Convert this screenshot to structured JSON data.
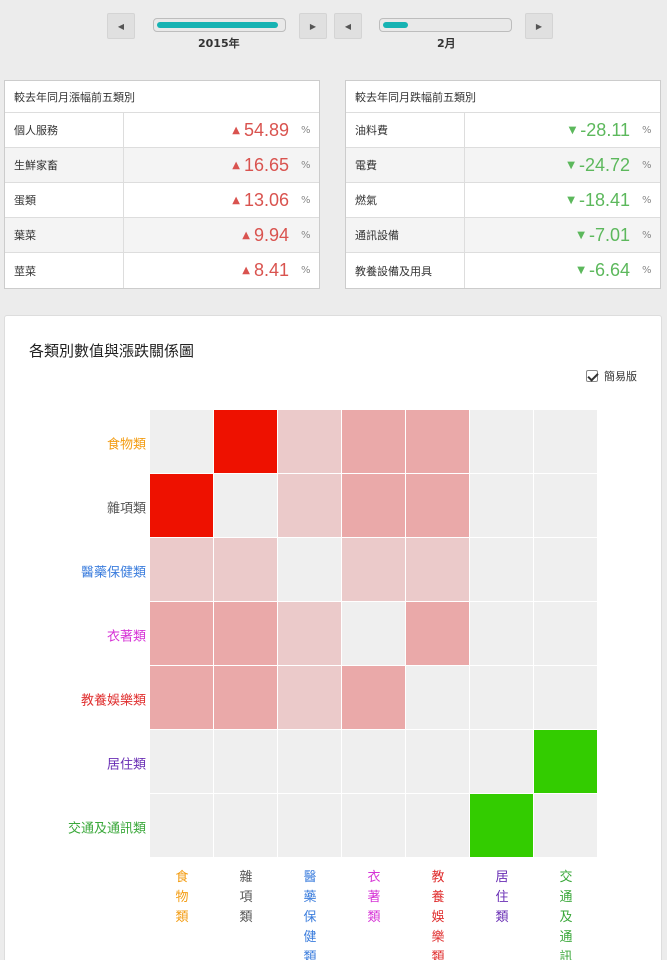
{
  "controls": {
    "year_label": "2015年",
    "month_label": "2月",
    "year_progress": 0.95,
    "month_progress": 0.2,
    "prev_glyph": "◀",
    "next_glyph": "▶"
  },
  "rise_table": {
    "title": "較去年同月漲幅前五類別",
    "unit": "%",
    "rows": [
      {
        "name": "個人服務",
        "value": "54.89"
      },
      {
        "name": "生鮮家畜",
        "value": "16.65"
      },
      {
        "name": "蛋類",
        "value": "13.06"
      },
      {
        "name": "葉菜",
        "value": "9.94"
      },
      {
        "name": "莖菜",
        "value": "8.41"
      }
    ]
  },
  "fall_table": {
    "title": "較去年同月跌幅前五類別",
    "unit": "%",
    "rows": [
      {
        "name": "油料費",
        "value": "-28.11"
      },
      {
        "name": "電費",
        "value": "-24.72"
      },
      {
        "name": "燃氣",
        "value": "-18.41"
      },
      {
        "name": "通訊設備",
        "value": "-7.01"
      },
      {
        "name": "教養設備及用具",
        "value": "-6.64"
      }
    ]
  },
  "chart": {
    "title": "各類別數值與漲跌關係圖",
    "simple_label": "簡易版",
    "simple_checked": true
  },
  "chart_data": {
    "type": "heatmap",
    "categories": [
      "食物類",
      "雜項類",
      "醫藥保健類",
      "衣著類",
      "教養娛樂類",
      "居住類",
      "交通及通訊類"
    ],
    "category_colors": [
      "#f39c12",
      "#555555",
      "#3b7ddd",
      "#d633d6",
      "#e03030",
      "#6a2fb5",
      "#3aa83a"
    ],
    "levels": [
      [
        0,
        4,
        1,
        2,
        2,
        0,
        0
      ],
      [
        4,
        0,
        1,
        2,
        2,
        0,
        0
      ],
      [
        1,
        1,
        0,
        1,
        1,
        0,
        0
      ],
      [
        2,
        2,
        1,
        0,
        2,
        0,
        0
      ],
      [
        2,
        2,
        1,
        2,
        0,
        0,
        0
      ],
      [
        0,
        0,
        0,
        0,
        0,
        0,
        5
      ],
      [
        0,
        0,
        0,
        0,
        0,
        5,
        0
      ]
    ],
    "level_colors": [
      "#efefef",
      "#ebcaca",
      "#eaa9a9",
      "#f0a0a0",
      "#ee1100",
      "#33cc00"
    ]
  }
}
